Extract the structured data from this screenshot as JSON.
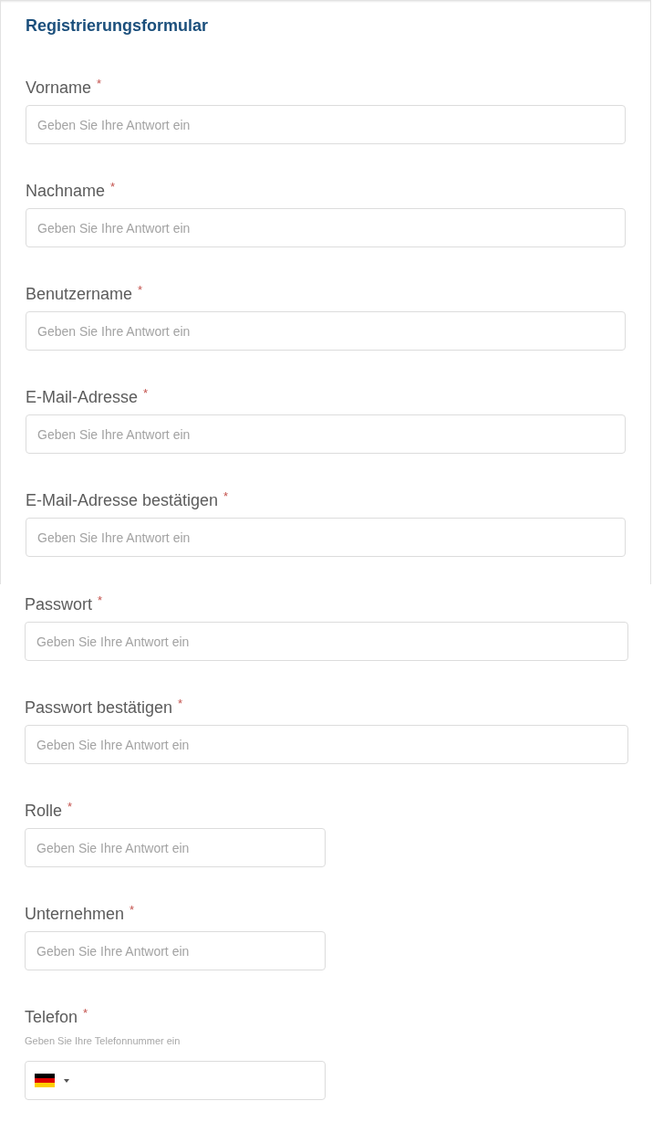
{
  "form": {
    "title": "Registrierungsformular",
    "sections": [
      {
        "framed": true,
        "fields": [
          {
            "kind": "wide",
            "label": "Vorname",
            "mark": "*",
            "placeholder": "Geben Sie Ihre Antwort ein"
          },
          {
            "kind": "wide",
            "label": "Nachname",
            "mark": "*",
            "placeholder": "Geben Sie Ihre Antwort ein"
          },
          {
            "kind": "wide",
            "label": "Benutzername",
            "mark": "*",
            "placeholder": "Geben Sie Ihre Antwort ein"
          },
          {
            "kind": "wide",
            "label": "E-Mail-Adresse",
            "mark": "*",
            "placeholder": "Geben Sie Ihre Antwort ein"
          },
          {
            "kind": "wide",
            "label": "E-Mail-Adresse bestätigen",
            "mark": "*",
            "placeholder": "Geben Sie Ihre Antwort ein"
          }
        ]
      },
      {
        "framed": false,
        "fields": [
          {
            "kind": "wide",
            "label": "Passwort",
            "mark": "*",
            "placeholder": "Geben Sie Ihre Antwort ein"
          },
          {
            "kind": "wide",
            "label": "Passwort bestätigen",
            "mark": "*",
            "placeholder": "Geben Sie Ihre Antwort ein"
          },
          {
            "kind": "narrow",
            "label": "Rolle",
            "mark": "*",
            "placeholder": "Geben Sie Ihre Antwort ein"
          },
          {
            "kind": "narrow",
            "label": "Unternehmen",
            "mark": "*",
            "placeholder": "Geben Sie Ihre Antwort ein"
          },
          {
            "kind": "phone",
            "label": "Telefon",
            "mark": "*",
            "hint": "Geben Sie Ihre Telefonnummer ein"
          }
        ]
      }
    ]
  }
}
